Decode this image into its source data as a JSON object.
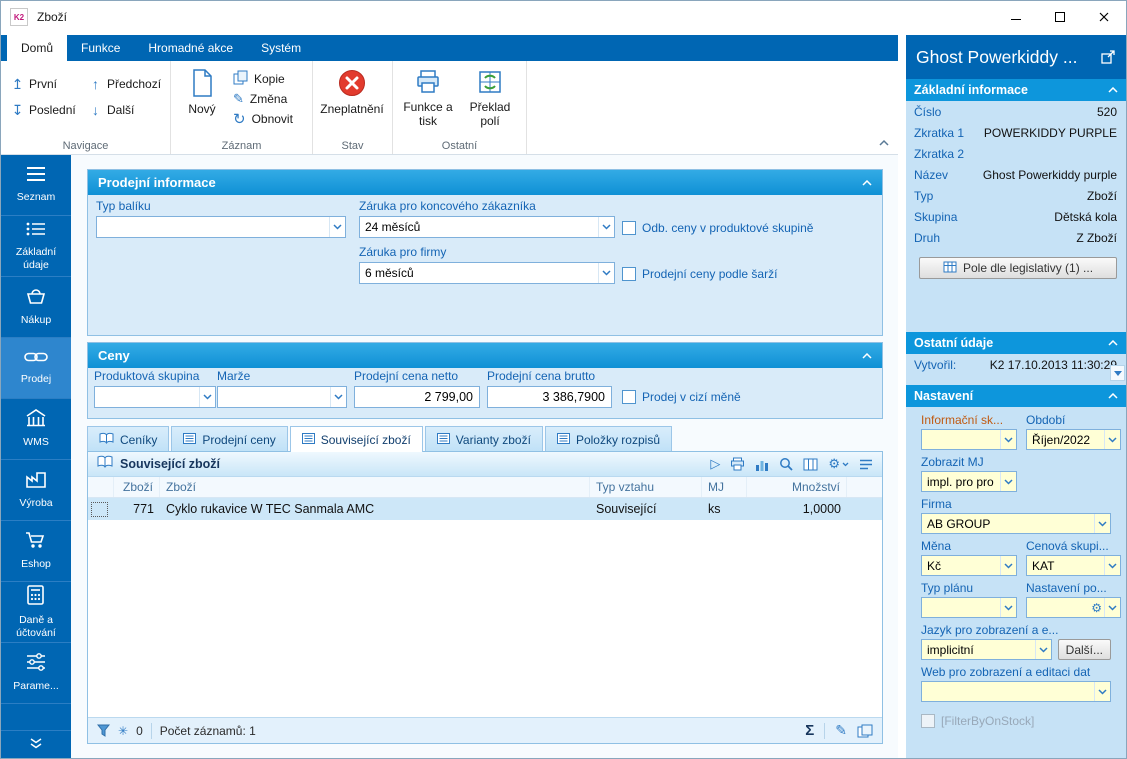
{
  "colors": {
    "brand_blue": "#0066B3",
    "section_blue": "#0F90D5",
    "panel_bg": "#D9EBF9",
    "right_panel_bg": "#C6E2F6",
    "field_yellow": "#FFFFD6",
    "invalid_red": "#E23B2E",
    "selected_row": "#CDE7F8"
  },
  "icons": {
    "logo": "K2",
    "arrow_up_bar": "↥",
    "arrow_down_bar": "↧",
    "arrow_up": "↑",
    "arrow_down": "↓",
    "refresh": "↻",
    "pencil": "✎",
    "play": "▷",
    "sigma": "Σ",
    "asterisk": "✳",
    "gear": "⚙"
  },
  "titlebar": {
    "title": "Zboží"
  },
  "ribbon": {
    "tabs": [
      {
        "label": "Domů"
      },
      {
        "label": "Funkce"
      },
      {
        "label": "Hromadné akce"
      },
      {
        "label": "Systém"
      }
    ],
    "navigace": {
      "label": "Navigace",
      "prvni": "První",
      "predchozi": "Předchozí",
      "posledni": "Poslední",
      "dalsi": "Další"
    },
    "zaznam": {
      "label": "Záznam",
      "novy": "Nový",
      "kopie": "Kopie",
      "zmena": "Změna",
      "obnovit": "Obnovit"
    },
    "stav": {
      "label": "Stav",
      "zneplatneni": "Zneplatnění"
    },
    "ostatni": {
      "label": "Ostatní",
      "funkce_a_tisk": "Funkce a tisk",
      "preklad_poli": "Překlad polí"
    }
  },
  "sidebar": {
    "items": [
      {
        "label": "Seznam"
      },
      {
        "label": "Základní údaje"
      },
      {
        "label": "Nákup"
      },
      {
        "label": "Prodej"
      },
      {
        "label": "WMS"
      },
      {
        "label": "Výroba"
      },
      {
        "label": "Eshop"
      },
      {
        "label": "Daně a účtování"
      },
      {
        "label": "Parame..."
      }
    ]
  },
  "prodejni": {
    "title": "Prodejní informace",
    "typ_baliku": {
      "label": "Typ balíku",
      "value": ""
    },
    "zaruka_zakaznik": {
      "label": "Záruka pro koncového zákazníka",
      "value": "24 měsíců"
    },
    "zaruka_firmy": {
      "label": "Záruka pro firmy",
      "value": "6 měsíců"
    },
    "cb_odb": "Odb. ceny v produktové skupině",
    "cb_sarze": "Prodejní ceny podle šarží"
  },
  "ceny": {
    "title": "Ceny",
    "produktova_skupina": {
      "label": "Produktová skupina",
      "value": ""
    },
    "marze": {
      "label": "Marže",
      "value": ""
    },
    "netto": {
      "label": "Prodejní cena netto",
      "value": "2 799,00"
    },
    "brutto": {
      "label": "Prodejní cena brutto",
      "value": "3 386,7900"
    },
    "cb_cizi": "Prodej v cizí měně"
  },
  "detail_tabs": [
    {
      "label": "Ceníky"
    },
    {
      "label": "Prodejní ceny"
    },
    {
      "label": "Související zboží"
    },
    {
      "label": "Varianty zboží"
    },
    {
      "label": "Položky rozpisů"
    }
  ],
  "table": {
    "title": "Související zboží",
    "columns": {
      "c1": "Zboží",
      "c2": "Zboží",
      "c3": "Typ vztahu",
      "c4": "MJ",
      "c5": "Množství"
    },
    "rows": [
      {
        "id": "771",
        "nazev": "Cyklo rukavice W TEC Sanmala AMC",
        "vztah": "Související",
        "mj": "ks",
        "mnozstvi": "1,0000"
      }
    ],
    "status": {
      "filter_count": "0",
      "count_label": "Počet záznamů: 1"
    }
  },
  "panel": {
    "title": "Ghost Powerkiddy ...",
    "zakladni": {
      "title": "Základní informace",
      "rows": [
        {
          "label": "Číslo",
          "value": "520"
        },
        {
          "label": "Zkratka 1",
          "value": "POWERKIDDY PURPLE"
        },
        {
          "label": "Zkratka 2",
          "value": ""
        },
        {
          "label": "Název",
          "value": "Ghost Powerkiddy purple"
        },
        {
          "label": "Typ",
          "value": "Zboží"
        },
        {
          "label": "Skupina",
          "value": "Dětská kola"
        },
        {
          "label": "Druh",
          "value": "Z Zboží"
        }
      ],
      "legislativa": "Pole dle legislativy (1) ..."
    },
    "ostatni": {
      "title": "Ostatní údaje",
      "vytvoril": {
        "label": "Vytvořil:",
        "value": "K2 17.10.2013 11:30:29"
      }
    },
    "nastaveni": {
      "title": "Nastavení",
      "informacni": {
        "label": "Informační sk...",
        "value": ""
      },
      "obdobi": {
        "label": "Období",
        "value": "Říjen/2022"
      },
      "zobrazit_mj": {
        "label": "Zobrazit MJ",
        "value": "impl. pro pro"
      },
      "firma": {
        "label": "Firma",
        "value": "AB GROUP"
      },
      "mena": {
        "label": "Měna",
        "value": "Kč"
      },
      "cenova": {
        "label": "Cenová skupi...",
        "value": "KAT"
      },
      "typ_planu": {
        "label": "Typ plánu",
        "value": ""
      },
      "nastaveni_po": {
        "label": "Nastavení po...",
        "value": ""
      },
      "jazyk": {
        "label": "Jazyk pro zobrazení a e...",
        "value": "implicitní",
        "button": "Další..."
      },
      "web": {
        "label": "Web pro zobrazení a editaci dat",
        "value": ""
      },
      "filter_cb": "[FilterByOnStock]"
    }
  }
}
